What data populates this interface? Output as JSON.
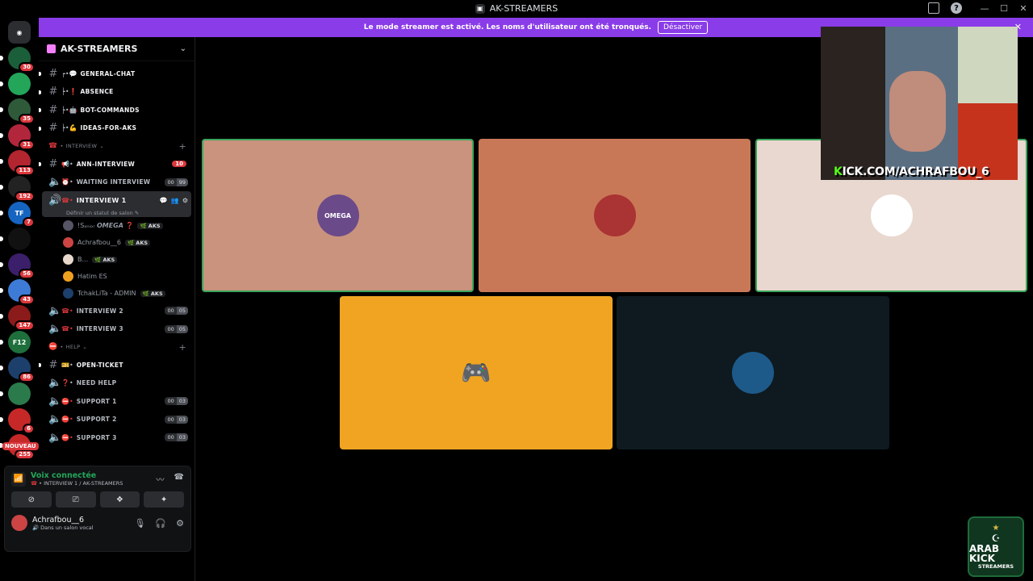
{
  "window": {
    "title": "AK-STREAMERS"
  },
  "banner": {
    "text": "Le mode streamer est activé. Les noms d'utilisateur ont été tronqués.",
    "button": "Désactiver"
  },
  "guilds": [
    {
      "label": "",
      "badge": "",
      "color": "#5865f2"
    },
    {
      "label": "",
      "badge": "30",
      "color": "#1b5e3a"
    },
    {
      "label": "",
      "badge": "",
      "color": "#23a55a"
    },
    {
      "label": "",
      "badge": "35",
      "color": "#2e5a3a"
    },
    {
      "label": "",
      "badge": "31",
      "color": "#b2263c"
    },
    {
      "label": "",
      "badge": "113",
      "color": "#b3252f"
    },
    {
      "label": "",
      "badge": "192",
      "color": "#222"
    },
    {
      "label": "TF",
      "badge": "7",
      "color": "#1565c0"
    },
    {
      "label": "",
      "badge": "",
      "color": "#111"
    },
    {
      "label": "",
      "badge": "56",
      "color": "#3b1f6b"
    },
    {
      "label": "",
      "badge": "43",
      "color": "#3d7bd6"
    },
    {
      "label": "",
      "badge": "147",
      "color": "#8b1a1a"
    },
    {
      "label": "F12",
      "badge": "",
      "color": "#1e6f3c"
    },
    {
      "label": "",
      "badge": "86",
      "color": "#1d3f6b"
    },
    {
      "label": "",
      "badge": "",
      "color": "#2b7a4b"
    },
    {
      "label": "",
      "badge": "6",
      "color": "#c62828"
    },
    {
      "label": "",
      "badge": "255",
      "color": "#c62828"
    }
  ],
  "guild_new_badge": "NOUVEAU",
  "server": {
    "name": "AK-STREAMERS"
  },
  "channels": {
    "text": [
      {
        "emoji": "┍•💬",
        "name": "GENERAL-CHAT"
      },
      {
        "emoji": "┝•❗",
        "name": "ABSENCE"
      },
      {
        "emoji": "┝•🤖",
        "name": "BOT-COMMANDS"
      },
      {
        "emoji": "┝•💪",
        "name": "IDEAS-FOR-AKS"
      }
    ],
    "cat_interview": "INTERVIEW",
    "ann": {
      "name": "ANN-INTERVIEW",
      "badge": "10"
    },
    "waiting": {
      "name": "WAITING INTERVIEW",
      "c1": "00",
      "c2": "99"
    },
    "active": {
      "name": "INTERVIEW 1",
      "status": "Définir un statut de salon ✎"
    },
    "members": [
      {
        "name": "!Sₐₙᵢₒᵣ 𝙊𝙈𝙀𝙂𝘼 ❓",
        "tag": "AKS",
        "color": "#556"
      },
      {
        "name": "Achrafbou__6",
        "tag": "AKS",
        "color": "#c44"
      },
      {
        "name": "B...",
        "tag": "AKS",
        "color": "#e8d8cc"
      },
      {
        "name": "Hatim ES",
        "tag": "",
        "color": "#f0a020"
      },
      {
        "name": "TchakLiTa - ADMIN",
        "tag": "AKS",
        "color": "#1d3f6b"
      }
    ],
    "interview2": {
      "name": "INTERVIEW 2",
      "c1": "00",
      "c2": "05"
    },
    "interview3": {
      "name": "INTERVIEW 3",
      "c1": "00",
      "c2": "05"
    },
    "cat_help": "HELP",
    "open_ticket": "OPEN-TICKET",
    "need_help": "NEED HELP",
    "supports": [
      {
        "name": "SUPPORT 1",
        "c1": "00",
        "c2": "03"
      },
      {
        "name": "SUPPORT 2",
        "c1": "00",
        "c2": "03"
      },
      {
        "name": "SUPPORT 3",
        "c1": "00",
        "c2": "03"
      }
    ]
  },
  "voice": {
    "status": "Voix connectée",
    "channel": "INTERVIEW 1 / AK-STREAMERS"
  },
  "user": {
    "name": "Achrafbou__6",
    "status": "Dans un salon vocal"
  },
  "tiles": [
    {
      "name": "OMEGA",
      "bg": "#c9937d",
      "speaking": true
    },
    {
      "name": "",
      "bg": "#c97857",
      "speaking": false
    },
    {
      "name": "",
      "bg": "#e9d8cf",
      "speaking": true
    },
    {
      "name": "",
      "bg": "#f0a421",
      "speaking": false
    },
    {
      "name": "",
      "bg": "#0e1a20",
      "speaking": false
    }
  ],
  "stream": {
    "url_prefix": "K",
    "url_rest": "ICK.COM/ACHRAFBOU_6"
  },
  "logo": {
    "line1": "ARAB KICK",
    "line2": "STREAMERS"
  },
  "colors": {
    "accent": "#8a3ce8",
    "online": "#23a55a",
    "badge": "#da373c"
  }
}
